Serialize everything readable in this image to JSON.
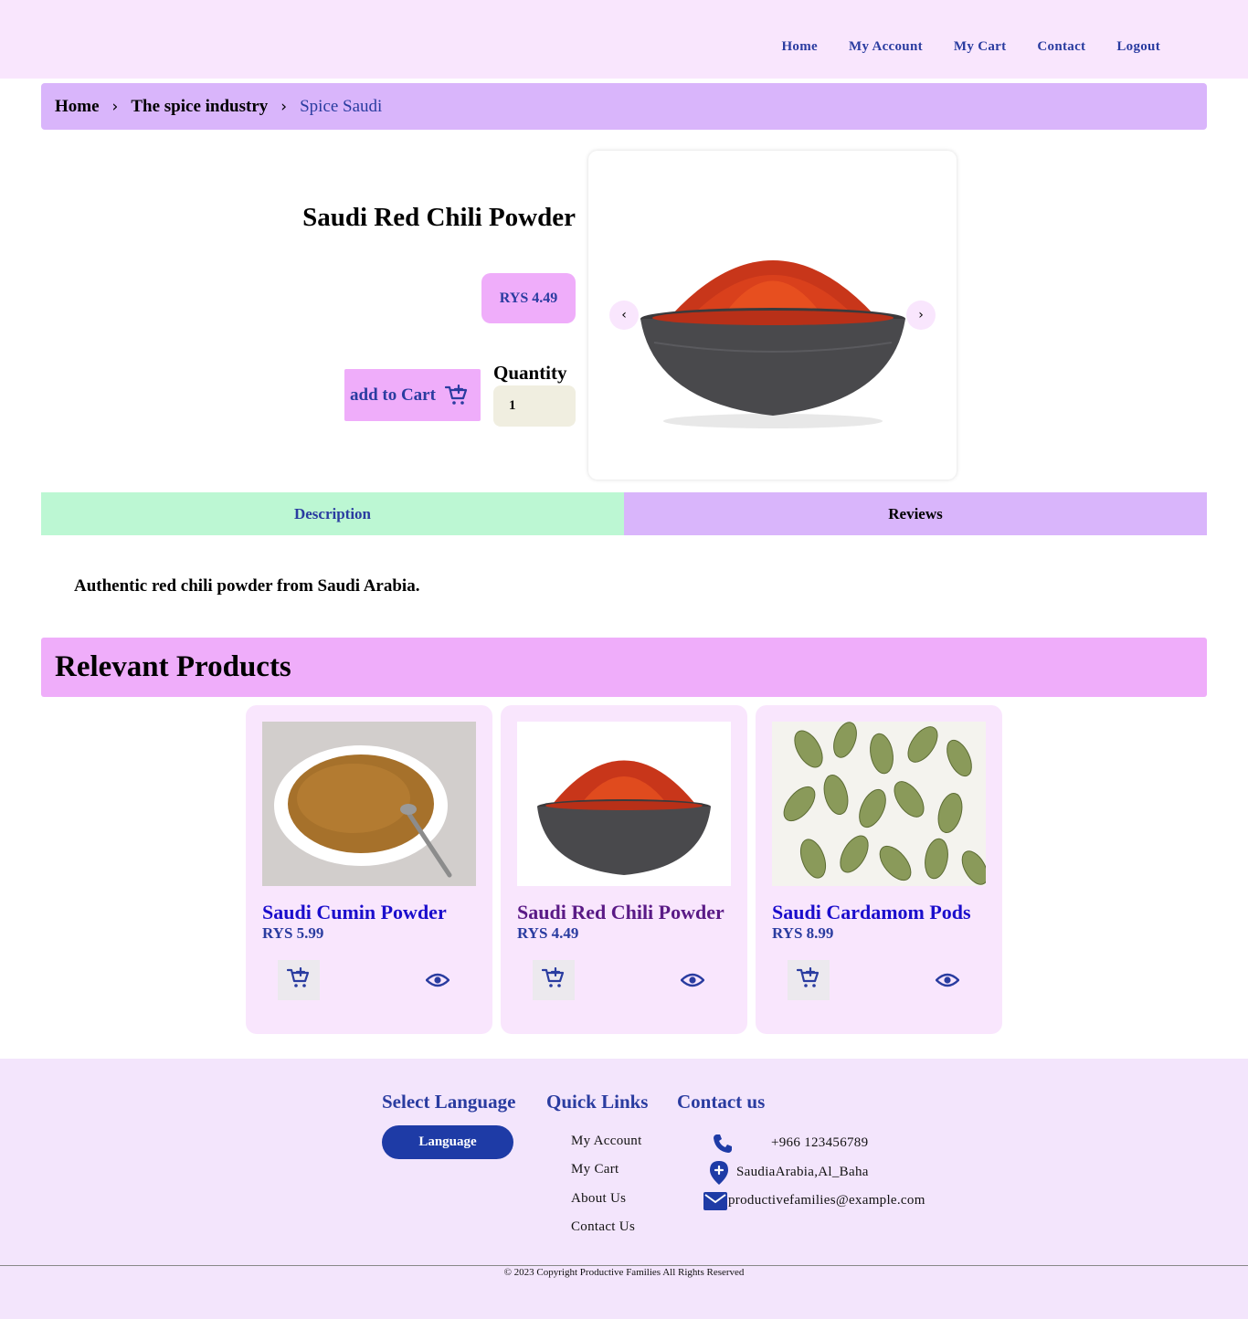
{
  "nav": {
    "items": [
      "Home",
      "My Account",
      "My Cart",
      "Contact",
      "Logout"
    ]
  },
  "breadcrumb": {
    "home": "Home",
    "category": "The spice industry",
    "current": "Spice Saudi",
    "separator": "›"
  },
  "product": {
    "title": "Saudi Red Chili Powder",
    "price": "RYS 4.49",
    "add_to_cart": "add to Cart",
    "quantity_label": "Quantity",
    "quantity_value": "1",
    "image_icon": "chili-powder-bowl-image",
    "prev": "‹",
    "next": "›"
  },
  "tabs": {
    "description": "Description",
    "reviews": "Reviews",
    "active": "Description",
    "description_text": "Authentic red chili powder from Saudi Arabia."
  },
  "relevant": {
    "heading": "Relevant Products",
    "products": [
      {
        "name": "Saudi Cumin Powder",
        "price": "RYS 5.99",
        "name_color": "#1a0dcc",
        "image": "cumin-powder-image"
      },
      {
        "name": "Saudi Red Chili Powder",
        "price": "RYS 4.49",
        "name_color": "#5a1a86",
        "image": "chili-powder-image"
      },
      {
        "name": "Saudi Cardamom Pods",
        "price": "RYS 8.99",
        "name_color": "#1a0dcc",
        "image": "cardamom-pods-image"
      }
    ]
  },
  "footer": {
    "select_language": "Select Language",
    "language_button": "Language",
    "quick_links_title": "Quick Links",
    "quick_links": [
      "My Account",
      "My Cart",
      "About Us",
      "Contact Us"
    ],
    "contact_title": "Contact us",
    "phone": "+966 123456789",
    "location": "SaudiaArabia,Al_Baha",
    "email": "productivefamilies@example.com",
    "copyright": "© 2023 Copyright Productive Families All Rights Reserved"
  },
  "colors": {
    "accent": "#2a3ca0",
    "header_bg": "#f9e6fd",
    "breadcrumb_bg": "#d9b5fb",
    "pill_bg": "#efadfa",
    "tab_active_bg": "#bcf7d3",
    "footer_bg": "#f3e5fc",
    "language_button_bg": "#1e3ba6"
  }
}
